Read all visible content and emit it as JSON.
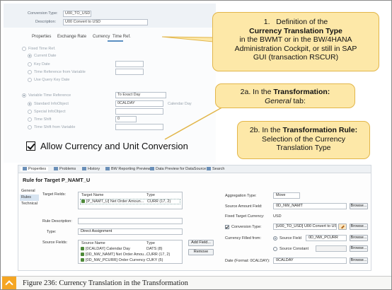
{
  "top_screenshot": {
    "conversion_type_label": "Conversion Type:",
    "conversion_type_value": "U00_TO_USD",
    "description_label": "Description:",
    "description_value": "U00 Convert to USD",
    "tabs": [
      "Properties",
      "Exchange Rate",
      "Currency",
      "Time Ref."
    ],
    "fixed_time_ref_label": "Fixed Time Ref.",
    "fixed_options": [
      "Current Date",
      "Key Date",
      "Time Reference from Variable",
      "Use Query Key Date"
    ],
    "variable_time_ref_label": "Variable Time Reference",
    "variable_time_ref_value": "To Exact Day",
    "variable_options": [
      "Standard InfoObject",
      "Special InfoObject",
      "Time Shift",
      "Time Shift from Variable"
    ],
    "standard_infoobject_value": "0CALDAY",
    "calendar_day_label": "Calendar Day",
    "time_shift_value": "0"
  },
  "callouts": {
    "c1_num": "1.",
    "c1_line1": "Definition of the",
    "c1_bold": "Currency Translation Type",
    "c1_line3": "in the BWMT or in the BW/4HANA",
    "c1_line4": "Administration Cockpit, or still in SAP",
    "c1_line5": "GUI (transaction RSCUR)",
    "c2a_prefix": "2a. In the ",
    "c2a_bold": "Transformation:",
    "c2a_italic": "General",
    "c2a_suffix": " tab:",
    "c2b_prefix": "2b. In the ",
    "c2b_bold": "Transformation Rule:",
    "c2b_line2": "Selection of the Currency",
    "c2b_line3": "Translation Type"
  },
  "allow_conversion_label": "Allow Currency and Unit Conversion",
  "bottom": {
    "view_tabs": [
      "Properties",
      "Problems",
      "History",
      "BW Reporting Preview",
      "Data Preview for DataSource",
      "Search"
    ],
    "title": "Rule for Target P_NAMT_U",
    "side_tabs": [
      "General",
      "Rules",
      "Technical"
    ],
    "target_fields_label": "Target Fields:",
    "col_target_name": "Target Name",
    "col_type": "Type",
    "target_row": {
      "name": "[P_NAMT_U] Net Order Amoun...",
      "type": "CURR (17, 2)"
    },
    "rule_description_label": "Rule Description:",
    "type_label": "Type:",
    "type_value": "Direct Assignment",
    "source_fields_label": "Source Fields:",
    "col_source_name": "Source Name",
    "source_rows": [
      {
        "name": "[0CALDAY] Calendar Day",
        "type": "DATS (8)"
      },
      {
        "name": "[0D_NW_NAMT] Net Order Amou...",
        "type": "CURR (17, 2)"
      },
      {
        "name": "[0D_NW_PCURR] Order Currency",
        "type": "CUKY (5)"
      }
    ],
    "add_field_label": "Add Field...",
    "remove_label": "Remove",
    "aggregation_type_label": "Aggregation Type:",
    "aggregation_type_value": "Move",
    "source_amount_field_label": "Source Amount Field:",
    "source_amount_field_value": "0D_NW_NAMT",
    "fixed_target_currency_label": "Fixed Target Currency:",
    "fixed_target_currency_value": "USD",
    "conversion_type_label": "Conversion Type:",
    "conversion_type_value": "[U00_TO_USD] U00 Convert to USD",
    "currency_filled_from_label": "Currency Filled from:",
    "source_field_option": "Source Field",
    "source_field_value": "0D_NW_PCURR",
    "source_constant_option": "Source Constant",
    "date_label": "Date (Format: 0CALDAY):",
    "date_value": "0CALDAY",
    "browse_label": "Browse..."
  },
  "caption": "Figure 236: Currency Translation in the Transformation",
  "colors": {
    "callout_fill": "#fde8a8",
    "callout_border": "#e2b64a",
    "caption_icon": "#f5a623"
  }
}
